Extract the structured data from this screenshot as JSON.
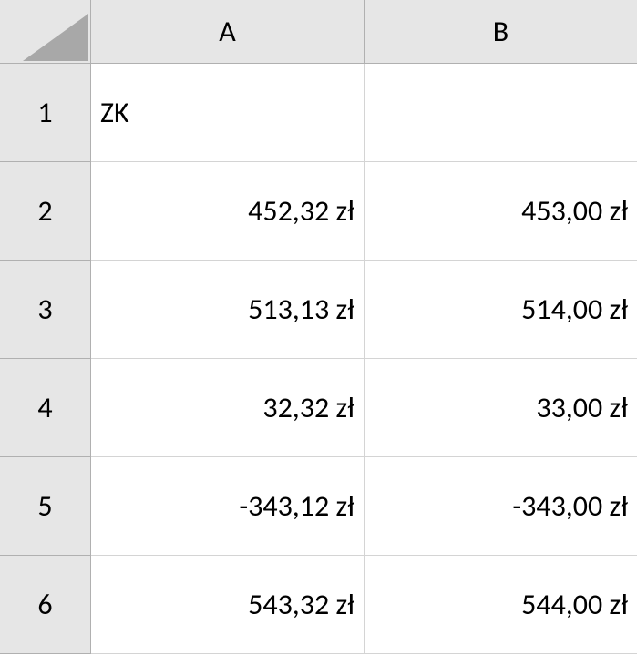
{
  "columns": [
    "A",
    "B"
  ],
  "row_headers": [
    "1",
    "2",
    "3",
    "4",
    "5",
    "6"
  ],
  "cells": {
    "A1": "ZK",
    "B1": "",
    "A2": "452,32 zł",
    "B2": "453,00 zł",
    "A3": "513,13 zł",
    "B3": "514,00 zł",
    "A4": "32,32 zł",
    "B4": "33,00 zł",
    "A5": "-343,12 zł",
    "B5": "-343,00 zł",
    "A6": "543,32 zł",
    "B6": "544,00 zł"
  }
}
